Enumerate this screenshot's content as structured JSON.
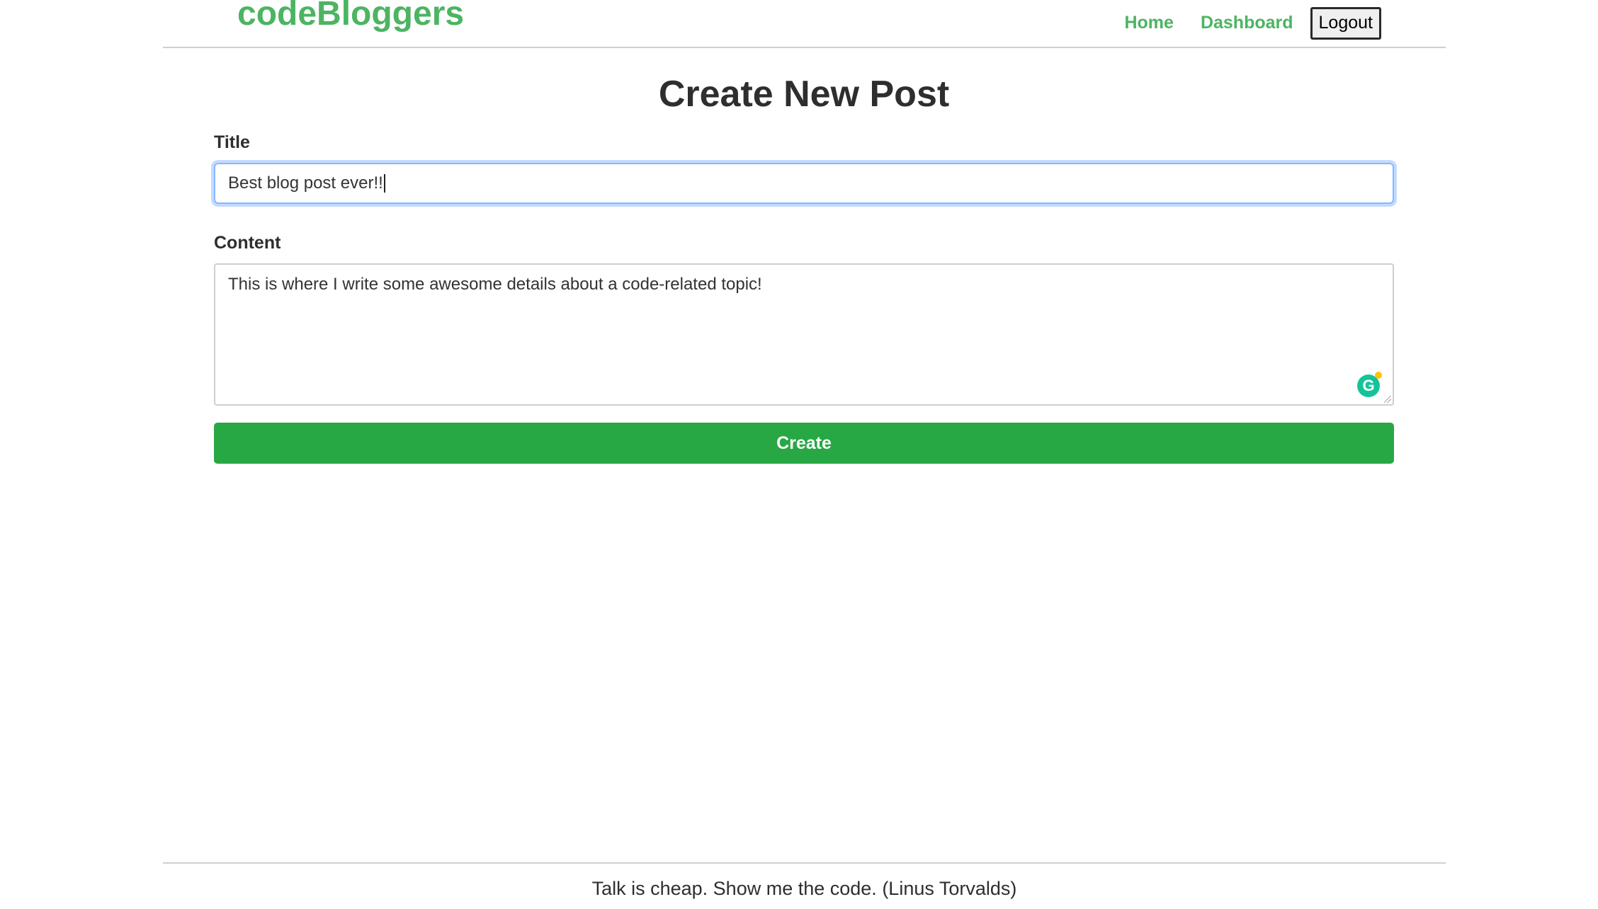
{
  "header": {
    "brand": "codeBloggers",
    "nav": {
      "home": "Home",
      "dashboard": "Dashboard",
      "logout": "Logout"
    }
  },
  "main": {
    "page_title": "Create New Post",
    "form": {
      "title_label": "Title",
      "title_value": "Best blog post ever!!",
      "content_label": "Content",
      "content_value": "This is where I write some awesome details about a code-related topic!",
      "submit_label": "Create"
    },
    "grammarly_glyph": "G"
  },
  "footer": {
    "quote": "Talk is cheap. Show me the code. (Linus Torvalds)"
  },
  "colors": {
    "brand_green": "#4cb462",
    "button_green": "#28a745",
    "focus_blue": "#86b7fe",
    "grammarly_green": "#15c39a"
  },
  "icons": {
    "grammarly": "grammarly-icon",
    "resize": "resize-handle-icon"
  }
}
